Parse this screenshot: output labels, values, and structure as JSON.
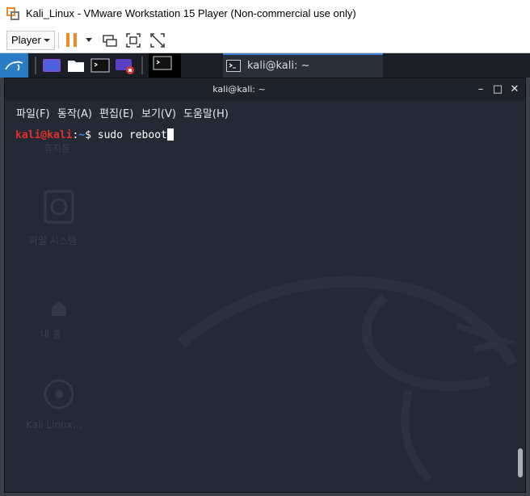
{
  "window": {
    "title": "Kali_Linux - VMware Workstation 15 Player (Non-commercial use only)"
  },
  "toolbar": {
    "player_label": "Player",
    "icons": [
      "pause-icon",
      "send-ctrl-alt-del-icon",
      "fit-guest-icon",
      "unity-icon"
    ]
  },
  "panel": {
    "task_label": "kali@kali: ~"
  },
  "terminal": {
    "title": "kali@kali: ~",
    "controls": {
      "minimize": "–",
      "maximize": "□",
      "close": "✕"
    },
    "menu": [
      "파일(F)",
      "동작(A)",
      "편집(E)",
      "보기(V)",
      "도움말(H)"
    ],
    "prompt_user": "kali@kali",
    "prompt_sep": ":",
    "prompt_path": "~",
    "prompt_symbol": "$",
    "command": " sudo reboot"
  },
  "desktop_icons": [
    "휴지통",
    "파일 시스템",
    "내 홈",
    "Kali Linux..."
  ],
  "colors": {
    "prompt_user": "#e0302c",
    "prompt_path": "#3c8ce6",
    "terminal_bg": "#232935",
    "panel_bg": "#1b1e25",
    "pause_accent": "#f08a24"
  }
}
